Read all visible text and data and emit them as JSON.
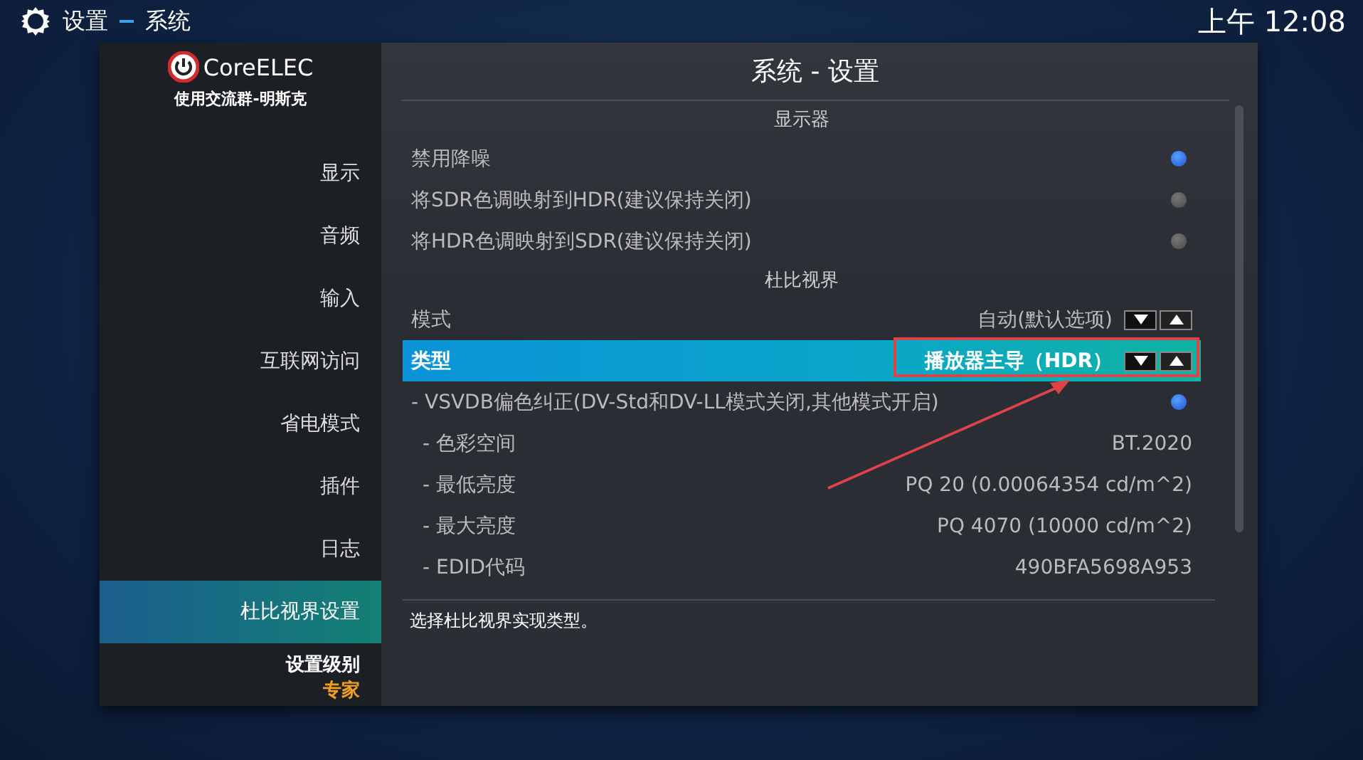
{
  "top_bar": {
    "breadcrumb": [
      "设置",
      "系统"
    ],
    "clock": "上午 12:08"
  },
  "sidebar": {
    "logo": "CoreELEC",
    "subtitle": "使用交流群-明斯克",
    "items": [
      {
        "label": "显示",
        "selected": false
      },
      {
        "label": "音频",
        "selected": false
      },
      {
        "label": "输入",
        "selected": false
      },
      {
        "label": "互联网访问",
        "selected": false
      },
      {
        "label": "省电模式",
        "selected": false
      },
      {
        "label": "插件",
        "selected": false
      },
      {
        "label": "日志",
        "selected": false
      },
      {
        "label": "杜比视界设置",
        "selected": true
      }
    ],
    "level": {
      "label": "设置级别",
      "value": "专家"
    }
  },
  "main": {
    "title": "系统 - 设置",
    "rows": [
      {
        "kind": "section",
        "label": "显示器"
      },
      {
        "kind": "toggle",
        "label": "禁用降噪",
        "on": true,
        "selected": false
      },
      {
        "kind": "toggle",
        "label": "将SDR色调映射到HDR(建议保持关闭)",
        "on": false,
        "selected": false
      },
      {
        "kind": "toggle",
        "label": "将HDR色调映射到SDR(建议保持关闭)",
        "on": false,
        "selected": false
      },
      {
        "kind": "section",
        "label": "杜比视界"
      },
      {
        "kind": "spinner",
        "label": "模式",
        "value": "自动(默认选项)",
        "selected": false
      },
      {
        "kind": "spinner",
        "label": "类型",
        "value": "播放器主导（HDR）",
        "selected": true
      },
      {
        "kind": "toggle",
        "label": "- VSVDB偏色纠正(DV-Std和DV-LL模式关闭,其他模式开启)",
        "on": true,
        "selected": false
      },
      {
        "kind": "value",
        "label": "- 色彩空间",
        "value": "BT.2020",
        "selected": false
      },
      {
        "kind": "value",
        "label": "- 最低亮度",
        "value": "PQ 20 (0.00064354 cd/m^2)",
        "selected": false
      },
      {
        "kind": "value",
        "label": "- 最大亮度",
        "value": "PQ 4070 (10000 cd/m^2)",
        "selected": false
      },
      {
        "kind": "value",
        "label": "- EDID代码",
        "value": "490BFA5698A953",
        "selected": false
      }
    ],
    "help": "选择杜比视界实现类型。"
  },
  "annotation": {
    "highlight_box": true,
    "arrow": true
  }
}
